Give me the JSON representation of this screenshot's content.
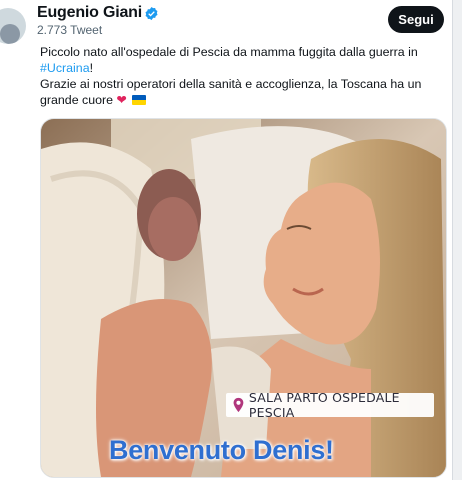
{
  "author": {
    "name": "Eugenio Giani",
    "tweet_count": "2.773 Tweet"
  },
  "follow_button": "Segui",
  "tweet": {
    "line1": "Piccolo nato all'ospedale di Pescia da mamma fuggita dalla guerra in",
    "hashtag": "#Ucraina",
    "after_hashtag": "!",
    "line3": "Grazie ai nostri operatori della sanità e accoglienza, la Toscana ha un",
    "line4": "grande cuore"
  },
  "media": {
    "location_label": "SALA PARTO OSPEDALE PESCIA",
    "caption": "Benvenuto Denis!"
  },
  "colors": {
    "accent": "#1d9bf0",
    "follow_bg": "#0f1419",
    "caption": "#2f6fd0",
    "pin": "#b0367c"
  },
  "icons": [
    "verified-badge-icon",
    "red-heart-icon",
    "ukraine-flag-icon",
    "location-pin-icon"
  ]
}
